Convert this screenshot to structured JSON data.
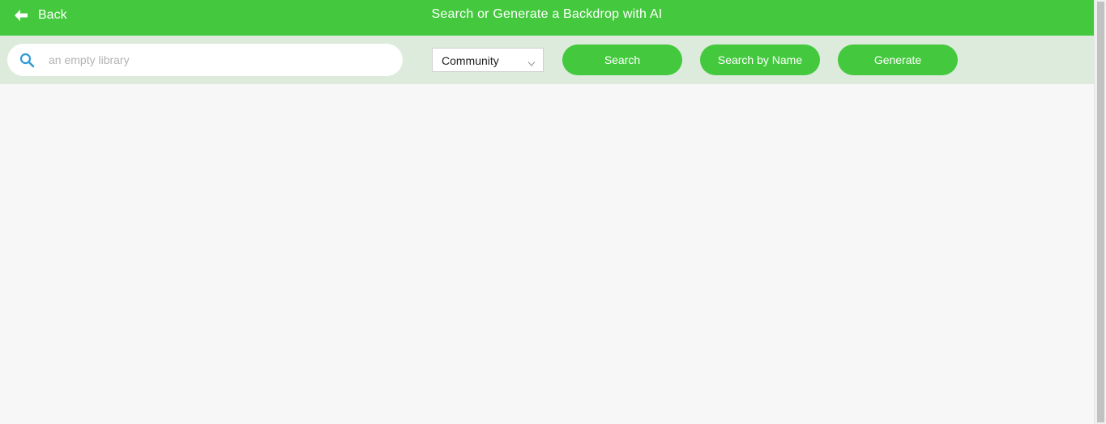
{
  "header": {
    "back_label": "Back",
    "title": "Search or Generate a Backdrop with AI",
    "back_icon": "arrow-left-icon",
    "background": "#44c93e"
  },
  "toolbar": {
    "background": "#dcebdc",
    "search": {
      "placeholder": "an empty library",
      "value": "",
      "icon": "search-icon",
      "icon_color": "#2e9bd6"
    },
    "filter_select": {
      "selected": "Community",
      "icon": "chevron-down-icon"
    },
    "buttons": {
      "search_label": "Search",
      "search_by_name_label": "Search by Name",
      "generate_label": "Generate"
    },
    "accent": "#44c93e"
  },
  "results": {
    "items": []
  }
}
